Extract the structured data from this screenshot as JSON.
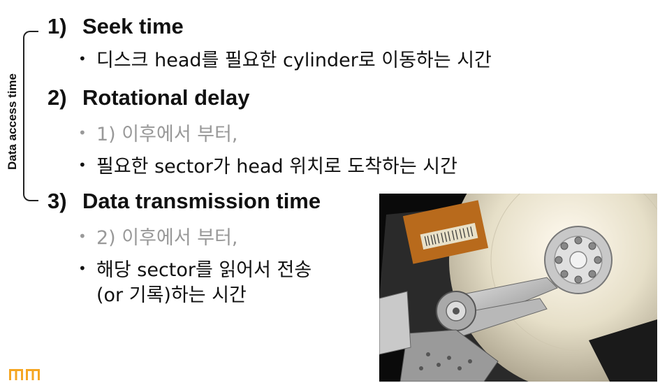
{
  "side_label": "Data access time",
  "items": [
    {
      "num": "1)",
      "title": "Seek time",
      "bullets": [
        {
          "text": "디스크 head를 필요한 cylinder로 이동하는 시간"
        }
      ]
    },
    {
      "num": "2)",
      "title": "Rotational delay",
      "bullets": [
        {
          "text": "1) 이후에서 부터,"
        },
        {
          "text": "필요한 sector가 head 위치로 도착하는 시간"
        }
      ]
    },
    {
      "num": "3)",
      "title": "Data transmission time",
      "bullets": [
        {
          "text": "2) 이후에서 부터,"
        },
        {
          "text": "해당 sector를 읽어서 전송",
          "cont": "(or 기록)하는 시간"
        }
      ]
    }
  ],
  "bullet_glyph": "•",
  "colors": {
    "text": "#111111",
    "muted": "#999999",
    "logo": "#f5a623"
  },
  "icons": {
    "photo": "hard-disk-drive-photo",
    "logo": "university-logo-icon"
  }
}
